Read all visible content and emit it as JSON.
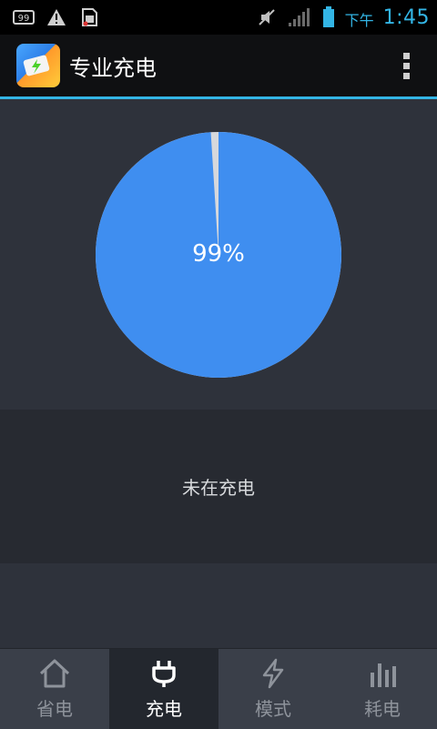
{
  "status_bar": {
    "time_prefix": "下午",
    "time": "1:45",
    "left_icons": [
      "notification-99-icon",
      "warning-icon",
      "sd-card-icon"
    ],
    "right_icons": [
      "mute-icon",
      "signal-icon",
      "battery-icon"
    ]
  },
  "action_bar": {
    "title": "专业充电",
    "accent_color": "#33b5e5"
  },
  "gauge": {
    "percent_label": "99%",
    "percent_value": 99,
    "fill_color": "#3f8ef0"
  },
  "charging_status": {
    "text": "未在充电"
  },
  "bottom_nav": {
    "tabs": [
      {
        "label": "省电",
        "icon": "home-icon",
        "active": false
      },
      {
        "label": "充电",
        "icon": "plug-icon",
        "active": true
      },
      {
        "label": "模式",
        "icon": "lightning-icon",
        "active": false
      },
      {
        "label": "耗电",
        "icon": "bar-chart-icon",
        "active": false
      }
    ]
  }
}
